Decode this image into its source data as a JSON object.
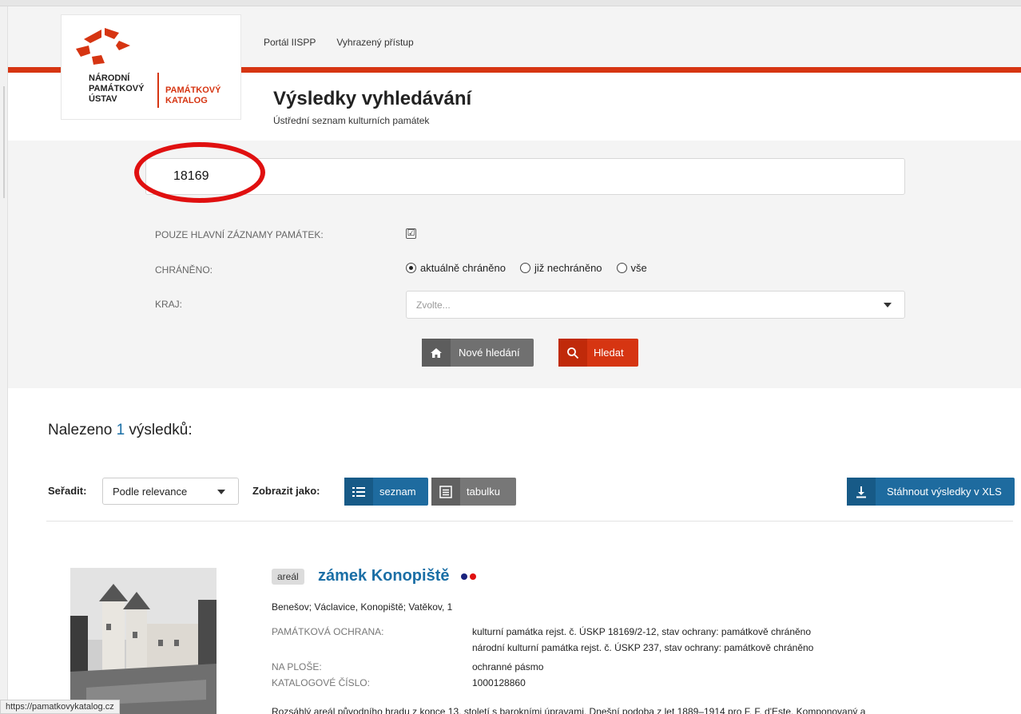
{
  "logo": {
    "left_lines": [
      "NÁRODNÍ",
      "PAMÁTKOVÝ",
      "ÚSTAV"
    ],
    "right_lines": [
      "PAMÁTKOVÝ",
      "KATALOG"
    ],
    "accent": "#d63512"
  },
  "topnav": [
    "Portál IISPP",
    "Vyhrazený přístup"
  ],
  "page": {
    "title": "Výsledky vyhledávání",
    "subtitle": "Ústřední seznam kulturních památek"
  },
  "search": {
    "value": "18169",
    "main_only_label": "POUZE HLAVNÍ ZÁZNAMY PAMÁTEK:",
    "main_only_checked": "☑",
    "protected_label": "CHRÁNĚNO:",
    "protected_options": [
      "aktuálně chráněno",
      "již nechráněno",
      "vše"
    ],
    "protected_selected": "aktuálně chráněno",
    "region_label": "KRAJ:",
    "region_placeholder": "Zvolte...",
    "new_search_label": "Nové hledání",
    "search_label": "Hledat"
  },
  "results": {
    "count_prefix": "Nalezeno ",
    "count": "1",
    "count_suffix": " výsledků:",
    "sort_label": "Seřadit:",
    "sort_value": "Podle relevance",
    "view_label": "Zobrazit jako:",
    "view_list": "seznam",
    "view_table": "tabulku",
    "download_label": "Stáhnout výsledky v XLS"
  },
  "item": {
    "type": "areál",
    "title": "zámek Konopiště",
    "dot_colors": [
      "#1a237e",
      "#e01010"
    ],
    "address": "Benešov; Václavice, Konopiště; Vatěkov, 1",
    "protection_label": "PAMÁTKOVÁ OCHRANA:",
    "protection_1": "kulturní památka rejst. č. ÚSKP 18169/2-12, stav ochrany: památkově chráněno",
    "protection_2": "národní kulturní památka rejst. č. ÚSKP 237, stav ochrany: památkově chráněno",
    "area_label": "NA PLOŠE:",
    "area_value": "ochranné pásmo",
    "catalog_label": "KATALOGOVÉ ČÍSLO:",
    "catalog_value": "1000128860",
    "description": "Rozsáhlý areál původního hradu z konce 13. století s barokními úpravami. Dnešní podoba z let 1889–1914 pro F. F. d'Este. Komponovaný a"
  },
  "status_url": "https://pamatkovykatalog.cz"
}
